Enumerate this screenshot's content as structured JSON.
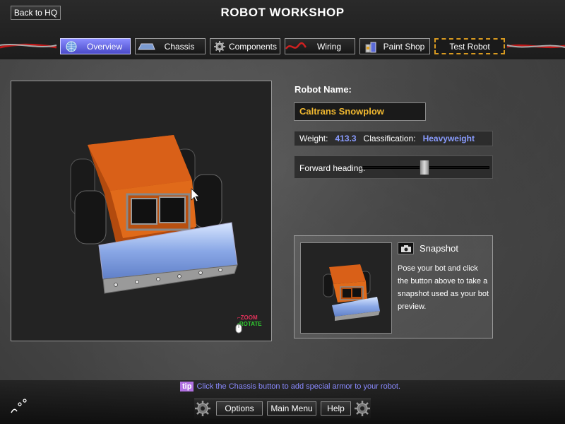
{
  "header": {
    "back_label": "Back to HQ",
    "title": "ROBOT WORKSHOP"
  },
  "tabs": [
    {
      "label": "Overview",
      "icon": "globe-icon",
      "active": true
    },
    {
      "label": "Chassis",
      "icon": "chassis-icon"
    },
    {
      "label": "Components",
      "icon": "gear-icon"
    },
    {
      "label": "Wiring",
      "icon": "wire-icon"
    },
    {
      "label": "Paint Shop",
      "icon": "paint-cans-icon"
    },
    {
      "label": "Test Robot",
      "icon": ""
    }
  ],
  "viewport": {
    "zoom_hint": "ZOOM",
    "rotate_hint": "ROTATE",
    "robot_color": "#d25a14",
    "plow_color": "#9ab8e8"
  },
  "robot": {
    "name_label": "Robot Name:",
    "name_value": "Caltrans Snowplow",
    "weight_label": "Weight:",
    "weight_value": "413.3",
    "class_label": "Classification:",
    "class_value": "Heavyweight",
    "heading_label": "Forward heading:",
    "heading_fraction": 0.49
  },
  "snapshot": {
    "title": "Snapshot",
    "description": "Pose your bot and click the button above to take a snapshot used as your bot preview."
  },
  "footer": {
    "tip_tag": "tip",
    "tip_text": "Click the Chassis button to add special armor to your robot.",
    "options_label": "Options",
    "main_menu_label": "Main Menu",
    "help_label": "Help"
  },
  "colors": {
    "accent": "#6b6ef0",
    "value_blue": "#8a9cff",
    "name_yellow": "#f0b830",
    "test_border": "#d89a20"
  }
}
